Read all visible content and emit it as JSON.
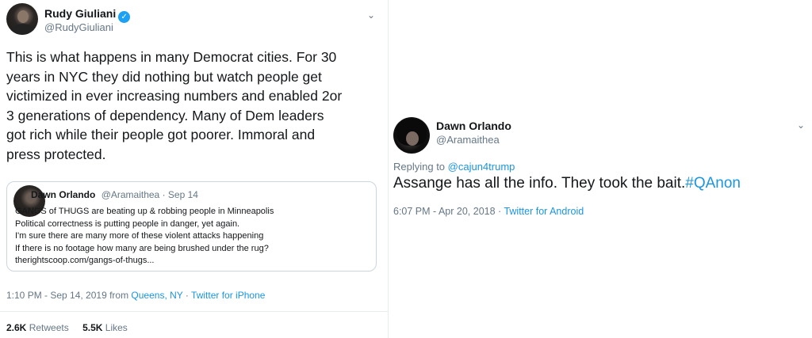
{
  "left_tweet": {
    "name": "Rudy Giuliani",
    "handle": "@RudyGiuliani",
    "text": "This is what happens in many Democrat cities. For 30\nyears in NYC they did nothing but watch people get\nvictimized in ever increasing numbers and enabled 2or\n3 generations of dependency. Many of Dem  leaders\ngot rich while their people got poorer. Immoral and\npress protected.",
    "quote": {
      "name": "Dawn Orlando",
      "handle": "@Aramaithea",
      "date": "Sep 14",
      "body": "GANGS of THUGS are beating up & robbing people in Minneapolis\nPolitical correctness is putting people in danger, yet again.\nI'm sure there are many more of these violent attacks  happening\nIf there is no footage how many are being brushed under the rug?\ntherightscoop.com/gangs-of-thugs..."
    },
    "timestamp": "1:10 PM - Sep 14, 2019 from ",
    "location": "Queens, NY",
    "source_sep": " · ",
    "source": "Twitter for iPhone",
    "retweets_count": "2.6K",
    "retweets_label": "Retweets",
    "likes_count": "5.5K",
    "likes_label": "Likes"
  },
  "right_tweet": {
    "name": "Dawn Orlando",
    "handle": "@Aramaithea",
    "replying_to_label": "Replying to ",
    "replying_to": "@cajun4trump",
    "text": "Assange has all the info. They took the bait.",
    "hashtag": "#QAnon",
    "timestamp": "6:07 PM - Apr 20, 2018 · ",
    "source": "Twitter for Android"
  },
  "icons": {
    "verified": "verified-badge-icon",
    "chevron": "chevron-down-icon"
  },
  "colors": {
    "link": "#1b95e0",
    "verified": "#1da1f2",
    "muted": "#657786",
    "text": "#14171a"
  }
}
